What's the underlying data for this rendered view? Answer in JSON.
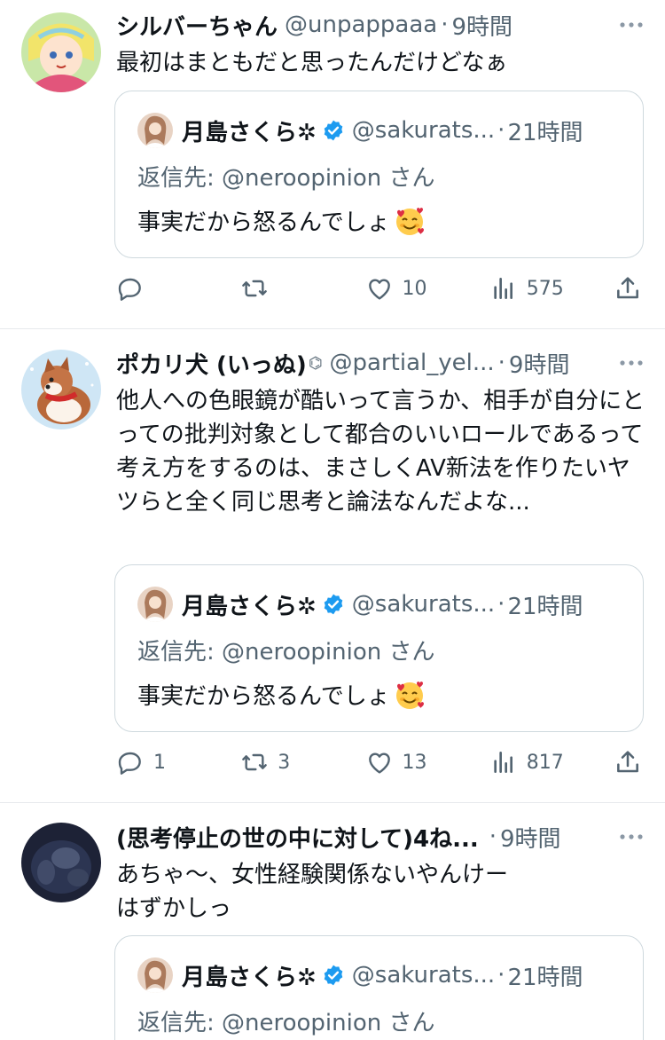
{
  "tweets": [
    {
      "display_name": "シルバーちゃん",
      "handle": "@unpappaaa",
      "separator": "·",
      "time": "9時間",
      "text": "最初はまともだと思ったんだけどなぁ",
      "quote": {
        "display_name": "月島さくら✲",
        "handle": "@sakurats...",
        "separator": "·",
        "time": "21時間",
        "reply_to": "返信先: @neroopinion さん",
        "text": "事実だから怒るんでしょ"
      },
      "stats": {
        "replies": "",
        "retweets": "",
        "likes": "10",
        "views": "575"
      }
    },
    {
      "display_name": "ポカリ犬 (いっぬ)",
      "name_badge": "⌬",
      "handle": "@partial_yel...",
      "separator": "·",
      "time": "9時間",
      "text": "他人への色眼鏡が酷いって言うか、相手が自分にとっての批判対象として都合のいいロールであるって考え方をするのは、まさしくAV新法を作りたいヤツらと全く同じ思考と論法なんだよな...",
      "quote": {
        "display_name": "月島さくら✲",
        "handle": "@sakurats...",
        "separator": "·",
        "time": "21時間",
        "reply_to": "返信先: @neroopinion さん",
        "text": "事実だから怒るんでしょ"
      },
      "stats": {
        "replies": "1",
        "retweets": "3",
        "likes": "13",
        "views": "817"
      }
    },
    {
      "display_name": "(思考停止の世の中に対して)4ね...",
      "handle": "",
      "separator": "·",
      "time": "9時間",
      "text": "あちゃ〜、女性経験関係ないやんけー\nはずかしっ",
      "quote": {
        "display_name": "月島さくら✲",
        "handle": "@sakurats...",
        "separator": "·",
        "time": "21時間",
        "reply_to": "返信先: @neroopinion さん",
        "text": ""
      }
    }
  ],
  "icons": {
    "more": "more-icon",
    "reply": "reply-icon",
    "retweet": "retweet-icon",
    "like": "heart-icon",
    "views": "views-icon",
    "share": "share-icon",
    "verified": "verified-badge-icon",
    "emoji": "smiling-face-with-hearts-emoji"
  },
  "colors": {
    "text": "#0f1419",
    "secondary": "#536471",
    "border": "#cfd9de",
    "divider": "#e6e9ec",
    "verified": "#1d9bf0"
  }
}
